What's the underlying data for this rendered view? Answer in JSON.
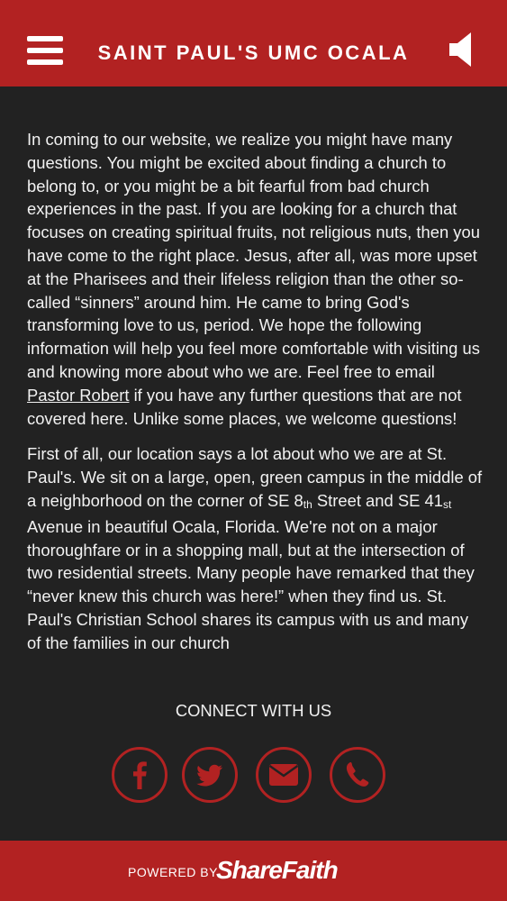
{
  "header": {
    "title": "SAINT PAUL'S UMC OCALA",
    "menu_icon": "hamburger-menu-icon",
    "sound_icon": "speaker-icon"
  },
  "content": {
    "p1_before": "In coming to our website, we realize you might have many questions.  You might be excited about finding a church to belong to, or you might be a bit fearful from bad church experiences in the past.  If you are looking for a church that focuses on creating spiritual fruits, not religious nuts, then you have come to the right place.  Jesus, after all, was more upset at the Pharisees and their lifeless religion than the other so-called “sinners” around him.  He came to bring God's transforming love to us, period.  We hope the following information will help you feel more comfortable with visiting us and knowing more about who we are.  Feel free to email ",
    "p1_link": "Pastor Robert",
    "p1_after": " if you have any further questions that are not covered here.  Unlike some places, we welcome questions!",
    "p2_a": "First of all, our location says a lot about who we are at St. Paul's. We sit on a large, open, green campus in the middle of a neighborhood on the corner of SE 8",
    "p2_sup1": "th",
    "p2_b": " Street and SE 41",
    "p2_sup2": "st",
    "p2_c": " Avenue in beautiful Ocala, Florida.  We're not on a major thoroughfare or in a shopping mall, but at the intersection of two residential streets.  Many people have remarked that they “never knew this church was here!” when they find us.  St. Paul's Christian School shares its campus with us and many of the families in our church"
  },
  "connect": {
    "heading": "CONNECT WITH US",
    "icons": [
      "facebook-icon",
      "twitter-icon",
      "email-icon",
      "phone-icon"
    ]
  },
  "footer": {
    "powered": "POWERED BY",
    "brand": "ShareFaith"
  },
  "colors": {
    "accent": "#b22222",
    "background": "#222222",
    "text": "#f2f2f2"
  }
}
